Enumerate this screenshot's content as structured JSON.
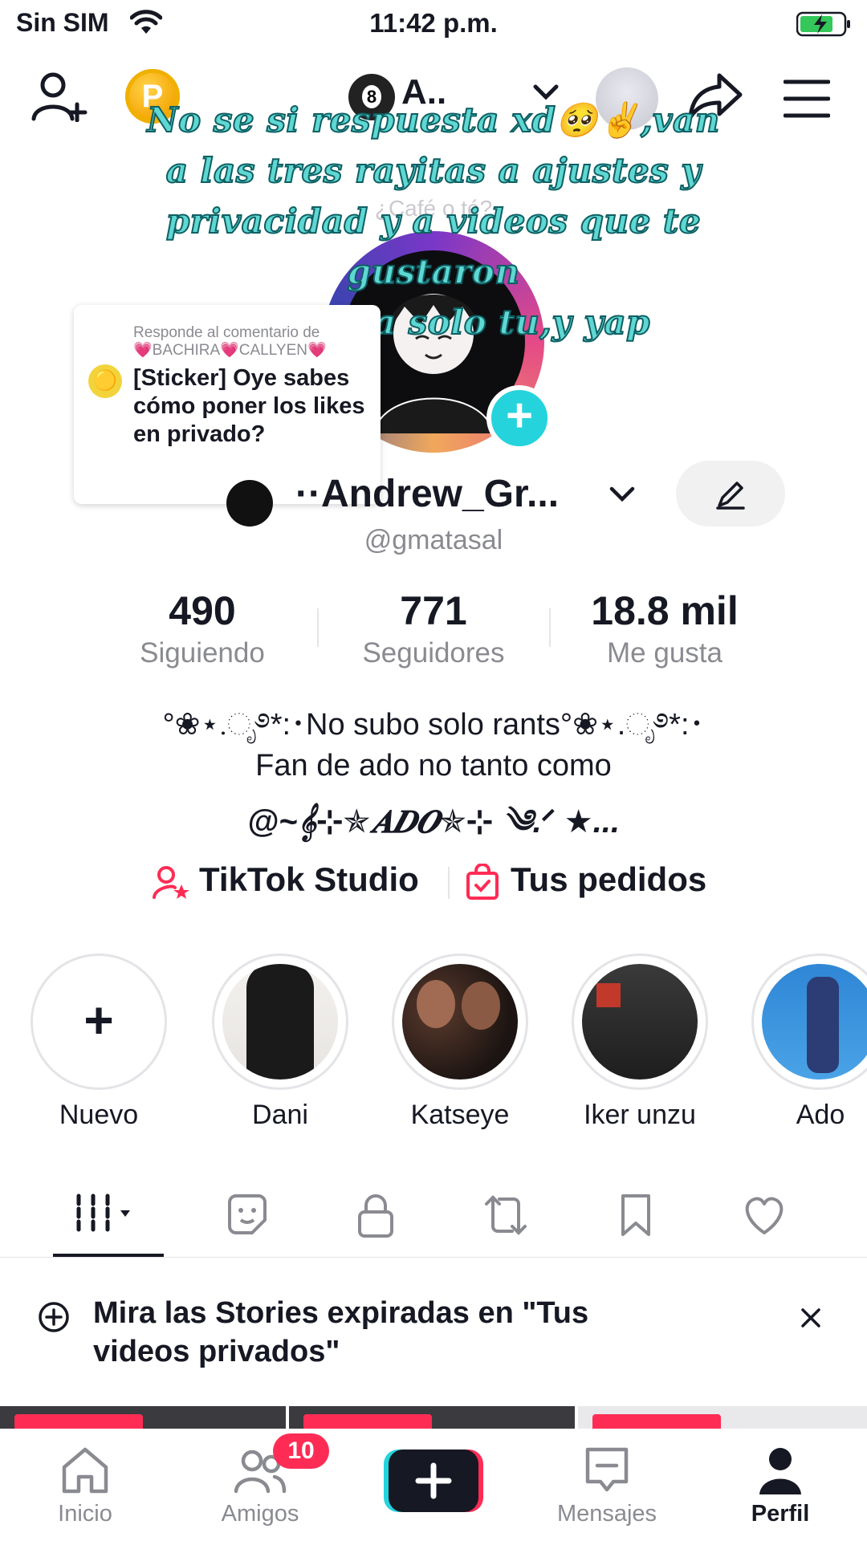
{
  "status_bar": {
    "carrier": "Sin SIM",
    "time": "11:42 p.m."
  },
  "header": {
    "coin_letter": "P",
    "account_chip": "A..",
    "ball_number": "8"
  },
  "caption_lines": [
    "No se si respuesta xd🥺✌️,van",
    "a las tres rayitas a ajustes y",
    "privacidad y a videos que te gustaron",
    "y le das a solo tu,y yap"
  ],
  "ghost_text": "¿Café o té?",
  "reply": {
    "heading": "Responde al comentario de",
    "author": "💗BACHIRA💗CALLYEN💗",
    "body": "[Sticker] Oye sabes cómo poner los likes en privado?"
  },
  "profile": {
    "display_name": "··Andrew_Gr...",
    "handle": "@gmatasal",
    "stats": [
      {
        "value": "490",
        "label": "Siguiendo"
      },
      {
        "value": "771",
        "label": "Seguidores"
      },
      {
        "value": "18.8 mil",
        "label": "Me gusta"
      }
    ],
    "bio_line1": "°❀⋆.ೃ࿔*:･No subo solo rants°❀⋆.ೃ࿔*:･",
    "bio_line2": "Fan de ado no tanto como",
    "bio_line3": "@~𝄞⊹✯𝑨𝑫𝑶✯⊹ ༄.ᐟ ★..."
  },
  "studio": {
    "studio_label": "TikTok Studio",
    "orders_label": "Tus pedidos"
  },
  "highlights": [
    {
      "label": "Nuevo"
    },
    {
      "label": "Dani"
    },
    {
      "label": "Katseye"
    },
    {
      "label": "Iker unzu"
    },
    {
      "label": "Ado"
    }
  ],
  "banner": {
    "text": "Mira las Stories expiradas en \"Tus videos privados\""
  },
  "bottom_nav": {
    "inicio": "Inicio",
    "amigos": "Amigos",
    "amigos_badge": "10",
    "mensajes": "Mensajes",
    "perfil": "Perfil"
  },
  "colors": {
    "accent": "#fe2c55",
    "teal": "#25d3dc",
    "caption": "#5fd7d2",
    "muted": "#8a8b91"
  }
}
